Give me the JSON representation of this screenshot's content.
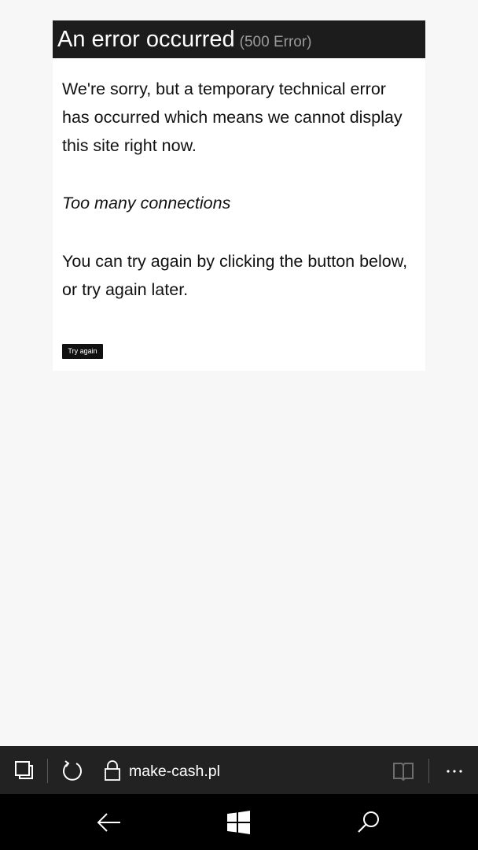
{
  "error_page": {
    "title": "An error occurred",
    "code": "(500 Error)",
    "message": "We're sorry, but a temporary technical error has occurred which means we cannot display this site right now.",
    "detail": "Too many connections",
    "instructions": "You can try again by clicking the button below, or try again later.",
    "button_label": "Try again"
  },
  "browser_bar": {
    "address": "make-cash.pl",
    "icons": [
      "tabs-icon",
      "refresh-icon",
      "lock-icon",
      "reading-view-icon",
      "more-icon"
    ]
  },
  "nav_bar": {
    "icons": [
      "back-arrow-icon",
      "windows-logo-icon",
      "search-icon"
    ]
  },
  "colors": {
    "page_background": "#f7f7f7",
    "card_background": "#ffffff",
    "header_background": "#1c1c1c",
    "browser_bar_background": "#222222",
    "nav_bar_background": "#000000"
  }
}
